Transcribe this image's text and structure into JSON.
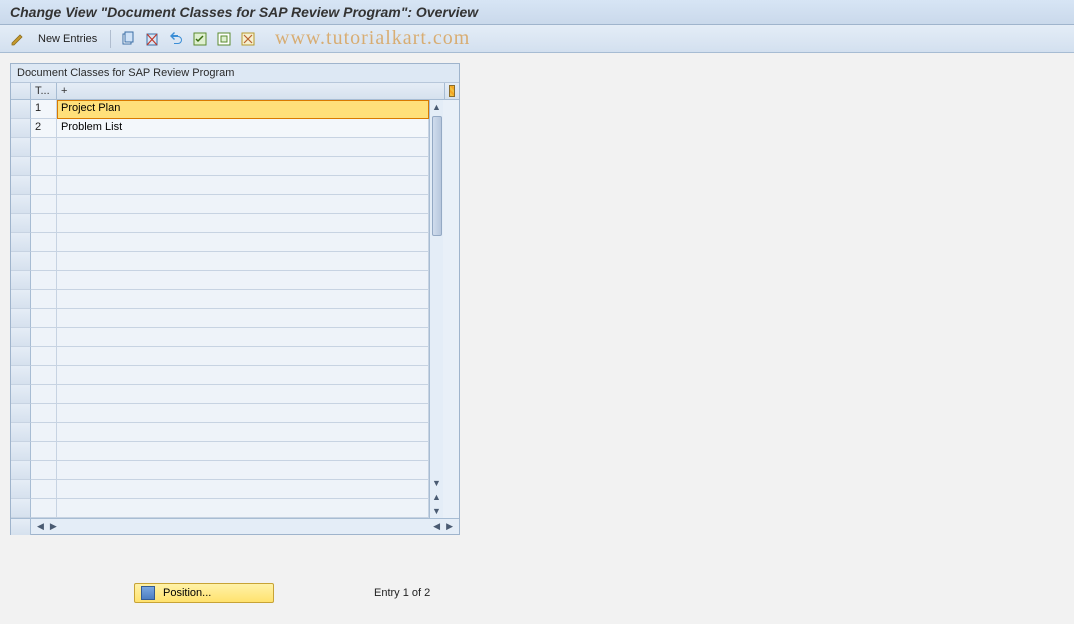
{
  "title": "Change View \"Document Classes for SAP Review Program\": Overview",
  "toolbar": {
    "new_entries_label": "New Entries"
  },
  "watermark": "www.tutorialkart.com",
  "panel": {
    "caption": "Document Classes for SAP Review Program",
    "columns": {
      "tid": "T...",
      "desc": "+"
    },
    "rows": [
      {
        "tid": "1",
        "desc": "Project Plan",
        "selected": true
      },
      {
        "tid": "2",
        "desc": "Problem List",
        "selected": false
      }
    ],
    "empty_row_count": 20
  },
  "footer": {
    "position_label": "Position...",
    "entry_text": "Entry 1 of 2"
  }
}
